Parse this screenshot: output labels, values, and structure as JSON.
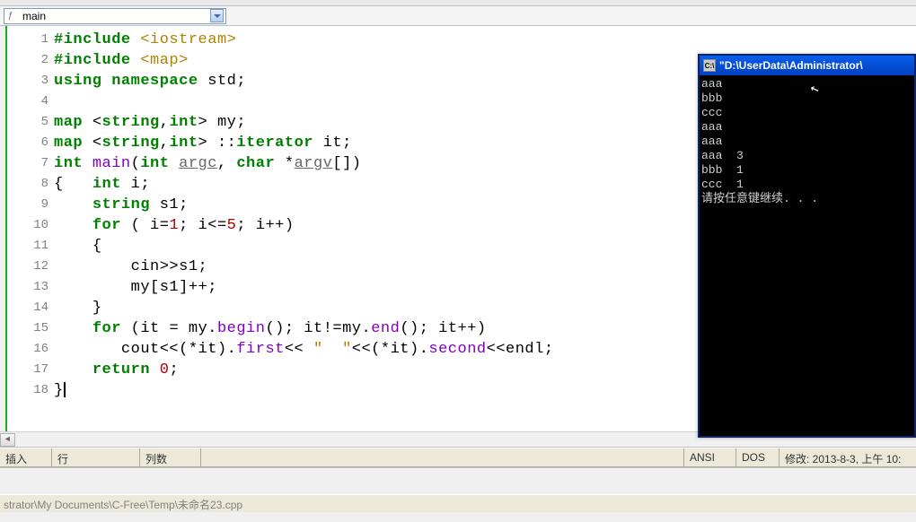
{
  "scope": {
    "label": "main"
  },
  "code": {
    "lines": [
      {
        "n": 1,
        "html": "<span class='pp'>#include</span> <span class='str'>&lt;iostream&gt;</span>"
      },
      {
        "n": 2,
        "html": "<span class='pp'>#include</span> <span class='str'>&lt;map&gt;</span>"
      },
      {
        "n": 3,
        "html": "<span class='kw'>using</span> <span class='kw'>namespace</span> std<span class='punc'>;</span>"
      },
      {
        "n": 4,
        "html": ""
      },
      {
        "n": 5,
        "html": "<span class='type'>map</span> <span class='punc'>&lt;</span><span class='type'>string</span><span class='punc'>,</span><span class='type'>int</span><span class='punc'>&gt;</span> my<span class='punc'>;</span>"
      },
      {
        "n": 6,
        "html": "<span class='type'>map</span> <span class='punc'>&lt;</span><span class='type'>string</span><span class='punc'>,</span><span class='type'>int</span><span class='punc'>&gt;</span> <span class='punc'>::</span><span class='type'>iterator</span> it<span class='punc'>;</span>"
      },
      {
        "n": 7,
        "html": "<span class='type'>int</span> <span class='fn'>main</span><span class='punc'>(</span><span class='type'>int</span> <span class='param'>argc</span><span class='punc'>,</span> <span class='type'>char</span> <span class='punc'>*</span><span class='param'>argv</span><span class='punc'>[])</span>"
      },
      {
        "n": 8,
        "html": "<span class='punc'>{</span>   <span class='type'>int</span> i<span class='punc'>;</span>"
      },
      {
        "n": 9,
        "html": "    <span class='type'>string</span> s1<span class='punc'>;</span>"
      },
      {
        "n": 10,
        "html": "    <span class='kw'>for</span> <span class='punc'>(</span> i<span class='punc'>=</span><span class='num'>1</span><span class='punc'>;</span> i<span class='punc'>&lt;=</span><span class='num'>5</span><span class='punc'>;</span> i<span class='punc'>++)</span>"
      },
      {
        "n": 11,
        "html": "    <span class='punc'>{</span>"
      },
      {
        "n": 12,
        "html": "        cin<span class='punc'>&gt;&gt;</span>s1<span class='punc'>;</span>"
      },
      {
        "n": 13,
        "html": "        my<span class='punc'>[</span>s1<span class='punc'>]++;</span>"
      },
      {
        "n": 14,
        "html": "    <span class='punc'>}</span>"
      },
      {
        "n": 15,
        "html": "    <span class='kw'>for</span> <span class='punc'>(</span>it <span class='punc'>=</span> my<span class='punc'>.</span><span class='fn'>begin</span><span class='punc'>();</span> it<span class='punc'>!=</span>my<span class='punc'>.</span><span class='fn'>end</span><span class='punc'>();</span> it<span class='punc'>++)</span>"
      },
      {
        "n": 16,
        "html": "       cout<span class='punc'>&lt;&lt;(*</span>it<span class='punc'>).</span><span class='fn'>first</span><span class='punc'>&lt;&lt;</span> <span class='str'>\"  \"</span><span class='punc'>&lt;&lt;(*</span>it<span class='punc'>).</span><span class='fn'>second</span><span class='punc'>&lt;&lt;</span>endl<span class='punc'>;</span>"
      },
      {
        "n": 17,
        "html": "    <span class='kw'>return</span> <span class='num'>0</span><span class='punc'>;</span>"
      },
      {
        "n": 18,
        "html": "<span class='punc'>}</span><span style='background:#000;width:2px;display:inline-block;height:17px;vertical-align:middle'></span>"
      }
    ]
  },
  "console": {
    "title_icon": "C:\\",
    "title": "\"D:\\UserData\\Administrator\\",
    "output": "aaa\nbbb\nccc\naaa\naaa\naaa  3\nbbb  1\nccc  1\n请按任意键继续. . ."
  },
  "status": {
    "insert": "插入",
    "line": "行",
    "col": "列数",
    "encoding": "ANSI",
    "eol": "DOS",
    "modified": "修改: 2013-8-3, 上午 10:"
  },
  "breadcrumb": "strator\\My Documents\\C-Free\\Temp\\未命名23.cpp"
}
